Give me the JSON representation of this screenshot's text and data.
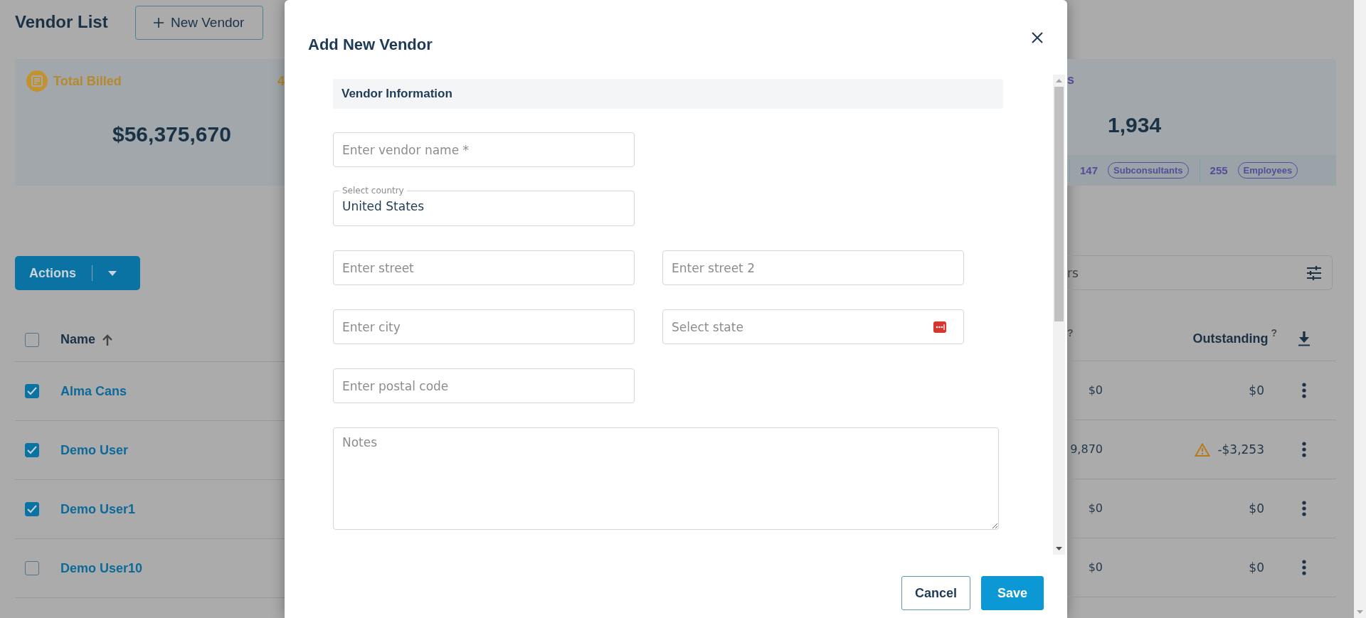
{
  "page": {
    "title": "Vendor List",
    "new_button": "New Vendor"
  },
  "summary": {
    "billed": {
      "label": "Total Billed",
      "value": "$56,375,670",
      "next_label_fragment": "4"
    },
    "count_card": {
      "label_fragment": "s",
      "value": "1,934",
      "counts": [
        {
          "count": "147",
          "tag": "Subconsultants"
        },
        {
          "count": "255",
          "tag": "Employees"
        }
      ]
    }
  },
  "actions_button": "Actions",
  "search": {
    "placeholder": "rs"
  },
  "table": {
    "select_all_checked": false,
    "name_column": "Name",
    "cut_column_help": "?",
    "outstanding_column": {
      "label": "Outstanding",
      "help": "?"
    },
    "rows": [
      {
        "name": "Alma Cans",
        "checked": true,
        "cut_value": "$0",
        "outstanding": "$0",
        "warning": false
      },
      {
        "name": "Demo User",
        "checked": true,
        "cut_value": "9,870",
        "outstanding": "-$3,253",
        "warning": true
      },
      {
        "name": "Demo User1",
        "checked": true,
        "cut_value": "$0",
        "outstanding": "$0",
        "warning": false
      },
      {
        "name": "Demo User10",
        "checked": false,
        "cut_value": "$0",
        "outstanding": "$0",
        "warning": false
      }
    ]
  },
  "modal": {
    "title": "Add New Vendor",
    "section": "Vendor Information",
    "rows": [
      {
        "fields": [
          {
            "kind": "text",
            "placeholder": "Enter vendor name *"
          }
        ]
      },
      {
        "fields": [
          {
            "kind": "select",
            "label": "Select country",
            "value": "United States"
          }
        ]
      },
      {
        "fields": [
          {
            "kind": "text",
            "placeholder": "Enter street"
          },
          {
            "kind": "text",
            "placeholder": "Enter street 2"
          }
        ]
      },
      {
        "fields": [
          {
            "kind": "text",
            "placeholder": "Enter city"
          },
          {
            "kind": "picker",
            "placeholder": "Select state"
          }
        ]
      },
      {
        "fields": [
          {
            "kind": "text",
            "placeholder": "Enter postal code"
          }
        ]
      },
      {
        "fields": [
          {
            "kind": "textarea",
            "placeholder": "Notes"
          }
        ]
      }
    ],
    "buttons": [
      {
        "label": "Cancel",
        "kind": "secondary"
      },
      {
        "label": "Save",
        "kind": "primary"
      }
    ]
  }
}
